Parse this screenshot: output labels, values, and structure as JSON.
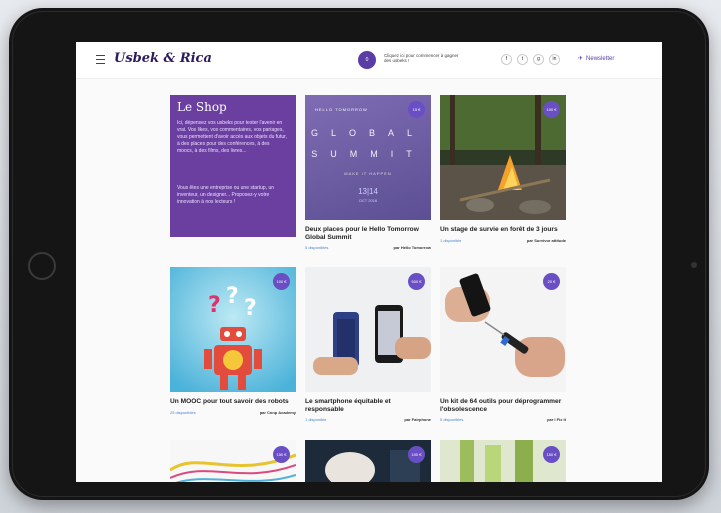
{
  "brand": {
    "name": "Usbek & Rica"
  },
  "header": {
    "coin_label": "0",
    "coin_text": "Cliquez ici pour commencer à gagner des usbeks !",
    "social": [
      "f",
      "t",
      "g",
      "in"
    ],
    "newsletter": "Newsletter"
  },
  "shop": {
    "title": "Le Shop",
    "para1": "Ici, dépensez vos usbeks pour tester l'avenir en vrai. Vos likes, vos commentaires, vos partages, vous permettent d'avoir accès aux objets du futur, à des places pour des conférences, à des moocs, à des films, des livres...",
    "para2": "Vous êtes une entreprise ou une startup, un inventeur, un designer... Proposez-y votre innovation à nos lecteurs !"
  },
  "cards": [
    {
      "title": "Deux places pour le Hello Tomorrow Global Summit",
      "availability": "5 disponibles",
      "by": "par Hello Tomorrow",
      "badge": "15 €",
      "image": {
        "kind": "poster",
        "header": "HELLO TOMORROW",
        "line1": "GLOBAL",
        "line2": "SUMMIT",
        "tagline": "MAKE IT HAPPEN",
        "date": "13|14",
        "month": "OCT 2016"
      }
    },
    {
      "title": "Un stage de survie en forêt de 3 jours",
      "availability": "1 disponible",
      "by": "par Survivor attitude",
      "badge": "100 €",
      "image": {
        "kind": "campfire-photo"
      }
    },
    {
      "title": "Un MOOC pour tout savoir des robots",
      "availability": "25 disponibles",
      "by": "par Cnnp Academy",
      "badge": "100 €",
      "image": {
        "kind": "robot-illustration"
      }
    },
    {
      "title": "Le smartphone équitable et responsable",
      "availability": "1 disponible",
      "by": "par Fairphone",
      "badge": "500 €",
      "image": {
        "kind": "phones-photo"
      }
    },
    {
      "title": "Un kit de 64 outils pour déprogrammer l'obsolescence",
      "availability": "5 disponibles",
      "by": "par I Fix It",
      "badge": "20 €",
      "image": {
        "kind": "toolkit-photo"
      }
    },
    {
      "title": "",
      "availability": "",
      "by": "",
      "badge": "150 €",
      "image": {
        "kind": "wave-illustration"
      }
    },
    {
      "title": "",
      "availability": "",
      "by": "",
      "badge": "100 €",
      "image": {
        "kind": "hand-photo"
      }
    },
    {
      "title": "",
      "availability": "",
      "by": "",
      "badge": "150 €",
      "image": {
        "kind": "plant-photo"
      }
    }
  ],
  "colors": {
    "brand_purple": "#6b3fa0",
    "accent_purple": "#6a4fc4",
    "link_blue": "#4a7fd0",
    "device": "#151515"
  }
}
